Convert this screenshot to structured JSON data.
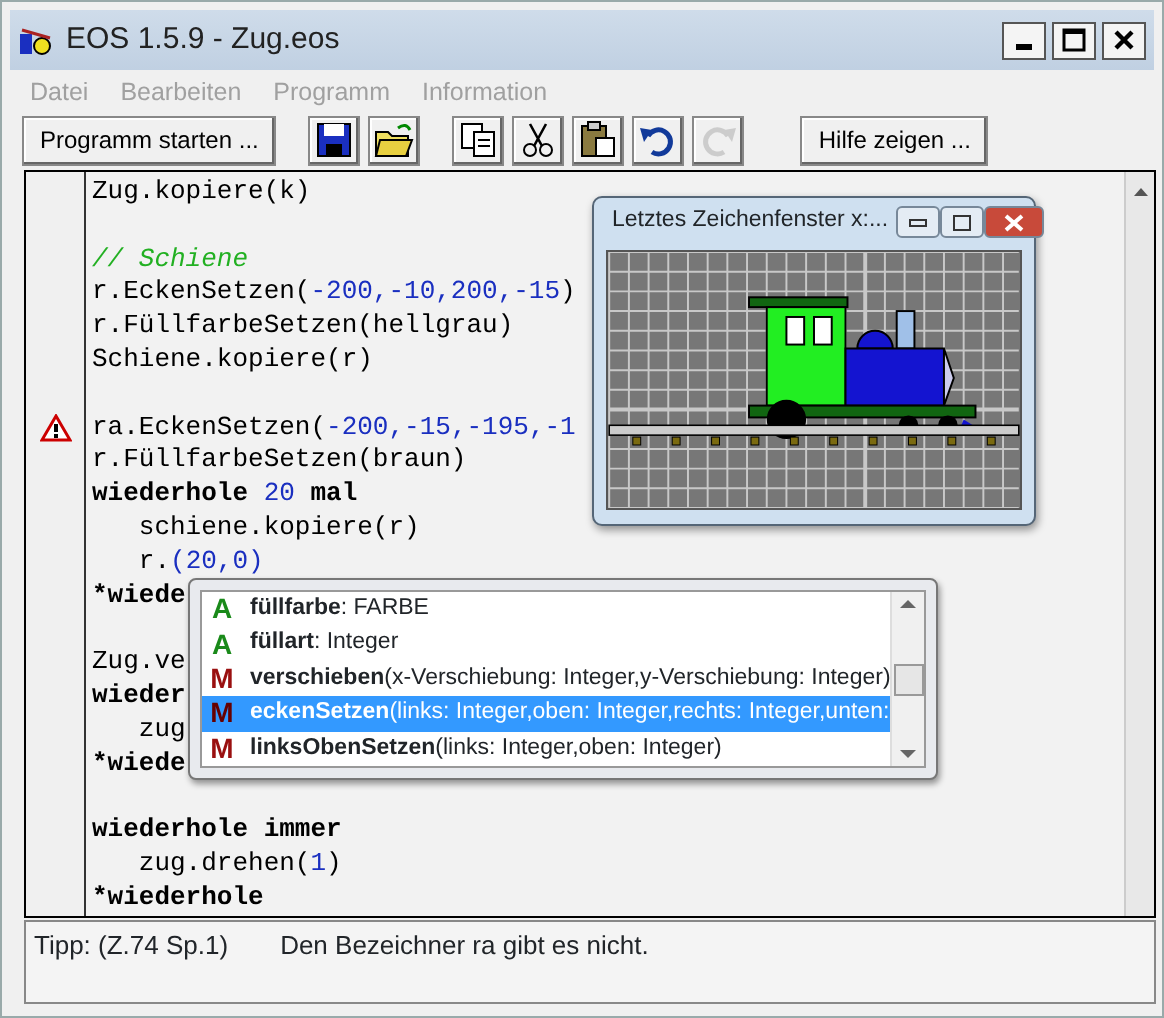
{
  "window": {
    "title": "EOS 1.5.9 - Zug.eos"
  },
  "menu": [
    {
      "label": "Datei",
      "disabled": true
    },
    {
      "label": "Bearbeiten",
      "disabled": true
    },
    {
      "label": "Programm",
      "disabled": true
    },
    {
      "label": "Information",
      "disabled": true
    }
  ],
  "toolbar": [
    {
      "kind": "text",
      "label": "Programm starten ...",
      "disabled": false
    },
    {
      "kind": "icon",
      "disabled": false
    },
    {
      "kind": "icon",
      "disabled": false
    },
    {
      "kind": "icon",
      "disabled": false
    },
    {
      "kind": "icon",
      "disabled": false
    },
    {
      "kind": "icon",
      "disabled": false
    },
    {
      "kind": "icon",
      "disabled": false
    },
    {
      "kind": "icon",
      "disabled": true
    },
    {
      "kind": "text",
      "label": "Hilfe zeigen ...",
      "disabled": false
    }
  ],
  "editor": {
    "lines": [
      {
        "error": false,
        "segments": [
          {
            "kind": "plain",
            "text": "Zug.kopiere(k)"
          }
        ]
      },
      {
        "error": false
      },
      {
        "error": false,
        "segments": [
          {
            "kind": "comment",
            "text": "// Schiene"
          }
        ]
      },
      {
        "error": false,
        "segments": [
          {
            "kind": "plain",
            "text": "r.EckenSetzen("
          },
          {
            "kind": "number",
            "text": "-200,-10,200,-15"
          },
          {
            "kind": "plain",
            "text": ")"
          }
        ]
      },
      {
        "error": false,
        "segments": [
          {
            "kind": "plain",
            "text": "r.FüllfarbeSetzen(hellgrau)"
          }
        ]
      },
      {
        "error": false,
        "segments": [
          {
            "kind": "plain",
            "text": "Schiene.kopiere(r)"
          }
        ]
      },
      {
        "error": false
      },
      {
        "error": true,
        "segments": [
          {
            "kind": "plain",
            "text": "ra.EckenSetzen("
          },
          {
            "kind": "number",
            "text": "-200,-15,-195,-1"
          }
        ]
      },
      {
        "error": false,
        "segments": [
          {
            "kind": "plain",
            "text": "r.FüllfarbeSetzen(braun)"
          }
        ]
      },
      {
        "error": false,
        "segments": [
          {
            "kind": "keyword",
            "text": "wiederhole"
          },
          {
            "kind": "number",
            "text": " 20"
          },
          {
            "kind": "keyword",
            "text": " mal"
          }
        ]
      },
      {
        "error": false,
        "segments": [
          {
            "kind": "plain",
            "text": "   schiene.kopiere(r)"
          }
        ]
      },
      {
        "error": false,
        "segments": [
          {
            "kind": "plain",
            "text": "   r."
          },
          {
            "kind": "number",
            "text": "(20,0)"
          }
        ]
      },
      {
        "error": false,
        "segments": [
          {
            "kind": "keyword",
            "text": "*wiede"
          }
        ]
      },
      {
        "error": false
      },
      {
        "error": false,
        "segments": [
          {
            "kind": "plain",
            "text": "Zug.ve"
          }
        ]
      },
      {
        "error": false,
        "segments": [
          {
            "kind": "keyword",
            "text": "wieder"
          }
        ]
      },
      {
        "error": false,
        "segments": [
          {
            "kind": "plain",
            "text": "   zug"
          }
        ]
      },
      {
        "error": false,
        "segments": [
          {
            "kind": "keyword",
            "text": "*wiede"
          }
        ]
      },
      {
        "error": false
      },
      {
        "error": false,
        "segments": [
          {
            "kind": "keyword",
            "text": "wiederhole immer"
          }
        ]
      },
      {
        "error": false,
        "segments": [
          {
            "kind": "plain",
            "text": "   zug.drehen("
          },
          {
            "kind": "number",
            "text": "1"
          },
          {
            "kind": "plain",
            "text": ")"
          }
        ]
      },
      {
        "error": false,
        "segments": [
          {
            "kind": "keyword",
            "text": "*wiederhole"
          }
        ]
      }
    ]
  },
  "drawing_window": {
    "title": "Letztes Zeichenfenster x:..."
  },
  "completion": {
    "items": [
      {
        "kind": "attribute",
        "marker": "A",
        "name": "füllfarbe",
        "detail": ": FARBE",
        "selected": false
      },
      {
        "kind": "attribute",
        "marker": "A",
        "name": "füllart",
        "detail": ": Integer",
        "selected": false
      },
      {
        "kind": "method",
        "marker": "M",
        "name": "verschieben",
        "detail": "(x-Verschiebung: Integer,y-Verschiebung: Integer)",
        "selected": false
      },
      {
        "kind": "method",
        "marker": "M",
        "name": "eckenSetzen",
        "detail": "(links: Integer,oben: Integer,rechts: Integer,unten:",
        "selected": true
      },
      {
        "kind": "method",
        "marker": "M",
        "name": "linksObenSetzen",
        "detail": "(links: Integer,oben: Integer)",
        "selected": false
      }
    ]
  },
  "status_bar": {
    "position": "Tipp: (Z.74 Sp.1)",
    "message": "Den Bezeichner ra gibt es nicht."
  }
}
